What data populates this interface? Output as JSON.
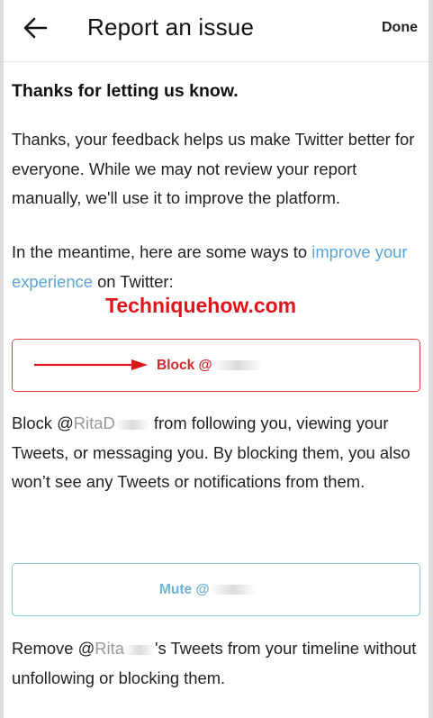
{
  "header": {
    "title": "Report an issue",
    "done_label": "Done",
    "back_icon": "arrow-left-icon"
  },
  "main": {
    "heading": "Thanks for letting us know.",
    "feedback_text": "Thanks, your feedback helps us make Twitter better for everyone. While we may not review your report manually, we'll use it to improve the platform.",
    "meantime_prefix": "In the meantime, here are some ways to ",
    "meantime_link": "improve your experience",
    "meantime_suffix": " on Twitter:",
    "watermark": "Techniquehow.com",
    "block_button": "Block @",
    "block_prefix": "Block @",
    "block_partial_handle": "RitaD",
    "block_text": " from following you, viewing your Tweets, or messaging you. By blocking them, you also won’t see any Tweets or notifications from them.",
    "mute_button": "Mute @",
    "mute_prefix": "Remove @",
    "mute_partial_handle": "Rita",
    "mute_text": "'s Tweets from your timeline without unfollowing or blocking them."
  },
  "colors": {
    "link": "#5aa4d8",
    "block_accent": "#d64545",
    "mute_accent": "#8cc7e4",
    "watermark": "#e0151b"
  }
}
